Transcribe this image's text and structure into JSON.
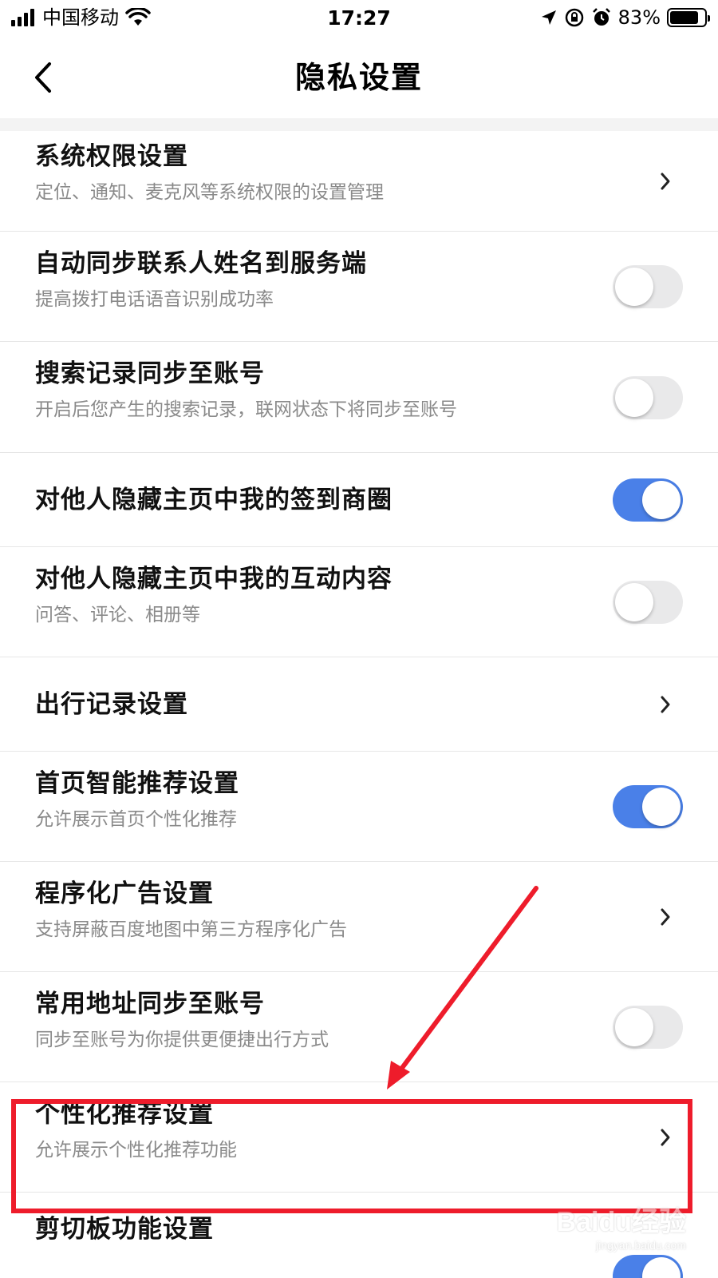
{
  "status_bar": {
    "carrier": "中国移动",
    "time": "17:27",
    "battery_percent": "83%",
    "battery_level": 0.83,
    "icons": [
      "signal-icon",
      "wifi-icon",
      "location-arrow-icon",
      "orientation-lock-icon",
      "alarm-icon",
      "battery-icon"
    ]
  },
  "nav": {
    "title": "隐私设置",
    "back_icon": "chevron-left-icon"
  },
  "settings": [
    {
      "title": "系统权限设置",
      "subtitle": "定位、通知、麦克风等系统权限的设置管理",
      "control": "chevron"
    },
    {
      "title": "自动同步联系人姓名到服务端",
      "subtitle": "提高拨打电话语音识别成功率",
      "control": "toggle",
      "on": false
    },
    {
      "title": "搜索记录同步至账号",
      "subtitle": "开启后您产生的搜索记录，联网状态下将同步至账号",
      "control": "toggle",
      "on": false
    },
    {
      "title": "对他人隐藏主页中我的签到商圈",
      "subtitle": "",
      "control": "toggle",
      "on": true
    },
    {
      "title": "对他人隐藏主页中我的互动内容",
      "subtitle": "问答、评论、相册等",
      "control": "toggle",
      "on": false
    },
    {
      "title": "出行记录设置",
      "subtitle": "",
      "control": "chevron"
    },
    {
      "title": "首页智能推荐设置",
      "subtitle": "允许展示首页个性化推荐",
      "control": "toggle",
      "on": true
    },
    {
      "title": "程序化广告设置",
      "subtitle": "支持屏蔽百度地图中第三方程序化广告",
      "control": "chevron"
    },
    {
      "title": "常用地址同步至账号",
      "subtitle": "同步至账号为你提供更便捷出行方式",
      "control": "toggle",
      "on": false
    },
    {
      "title": "个性化推荐设置",
      "subtitle": "允许展示个性化推荐功能",
      "control": "chevron"
    },
    {
      "title": "剪切板功能设置",
      "subtitle": "",
      "control": "toggle",
      "on": true
    }
  ],
  "annotation": {
    "highlight_color": "#ee1c2b",
    "highlighted_item": "个性化推荐设置"
  },
  "watermark": {
    "logo": "Baidu经验",
    "url": "jingyan.baidu.com"
  },
  "colors": {
    "toggle_on": "#4a80e8",
    "toggle_off": "#e9e9ea",
    "subtitle": "#8a8a8a",
    "divider": "#e6e6e6"
  }
}
